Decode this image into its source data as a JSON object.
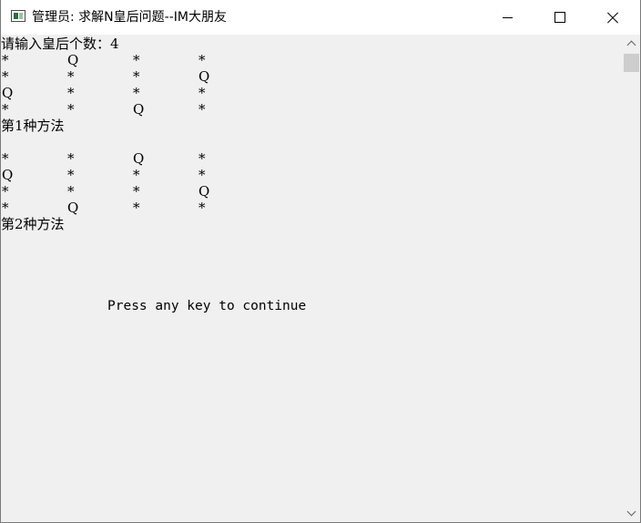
{
  "window": {
    "title": "管理员: 求解N皇后问题--IM大朋友",
    "icon": "console-app-icon"
  },
  "console": {
    "prompt": "请输入皇后个数：4",
    "solutions": [
      {
        "rows": [
          [
            "*",
            "Q",
            "*",
            "*"
          ],
          [
            "*",
            "*",
            "*",
            "Q"
          ],
          [
            "Q",
            "*",
            "*",
            "*"
          ],
          [
            "*",
            "*",
            "Q",
            "*"
          ]
        ],
        "label": "第1种方法"
      },
      {
        "rows": [
          [
            "*",
            "*",
            "Q",
            "*"
          ],
          [
            "Q",
            "*",
            "*",
            "*"
          ],
          [
            "*",
            "*",
            "*",
            "Q"
          ],
          [
            "*",
            "Q",
            "*",
            "*"
          ]
        ],
        "label": "第2种方法"
      }
    ],
    "continue_text": "Press any key to continue"
  },
  "colors": {
    "console_bg": "#f0f0f0",
    "titlebar_bg": "#ffffff",
    "text": "#000000"
  }
}
